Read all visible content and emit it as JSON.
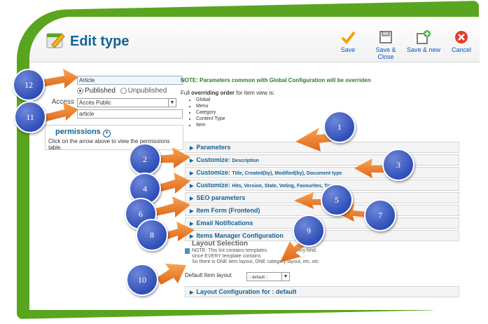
{
  "header": {
    "title": "Edit type",
    "toolbar": [
      {
        "label": "Save",
        "icon": "check-icon"
      },
      {
        "label": "Save & Close",
        "icon": "floppy-icon"
      },
      {
        "label": "Save & new",
        "icon": "save-new-icon"
      },
      {
        "label": "Cancel",
        "icon": "cancel-icon"
      }
    ]
  },
  "form": {
    "title_value": "Article",
    "published_label": "Published",
    "unpublished_label": "Unpublished",
    "published_selected": true,
    "access_label": "Access",
    "access_value": "Accès Public",
    "alias_value": "article",
    "permissions_title": "permissions",
    "permissions_note": "Click on the arrow above to view the permissions table."
  },
  "info": {
    "note_text": "NOTE: Parameters common with Global Configuration will be overriden",
    "order_prefix": "Full ",
    "order_bold": "overriding order",
    "order_suffix": " for item view is:",
    "order_items": [
      "Global",
      "Menu",
      "Category",
      "Content Type",
      "Item"
    ]
  },
  "panels": [
    {
      "label": "Parameters",
      "sub": ""
    },
    {
      "label": "Customize: ",
      "sub": "Description"
    },
    {
      "label": "Customize: ",
      "sub": "Title, Created(by), Modified(by), Document type"
    },
    {
      "label": "Customize: ",
      "sub": "Hits, Version, State, Voting, Favourites, Tags"
    },
    {
      "label": "SEO parameters",
      "sub": ""
    },
    {
      "label": "Item Form (Frontend)",
      "sub": ""
    },
    {
      "label": "Email Notifications",
      "sub": ""
    },
    {
      "label": "Items Manager Configuration",
      "sub": ""
    }
  ],
  "layout": {
    "title": "Layout Selection",
    "note_line1": "NOTE: This list contains templates",
    "note_line1_tail": "of every kind.",
    "note_line2": "since EVERY template contains",
    "note_line3": "So there is ONE item layout, ONE category layout, etc, etc",
    "default_label": "Default Item layout",
    "default_value": ":: default ::",
    "config_panel": "Layout Configuration for : default"
  },
  "callouts": [
    "1",
    "2",
    "3",
    "4",
    "5",
    "6",
    "7",
    "8",
    "9",
    "10",
    "11",
    "12"
  ],
  "colors": {
    "frame_green": "#5aa51f",
    "badge_blue": "#2f4fb8",
    "arrow_orange": "#f07c22",
    "title_blue": "#146295"
  }
}
